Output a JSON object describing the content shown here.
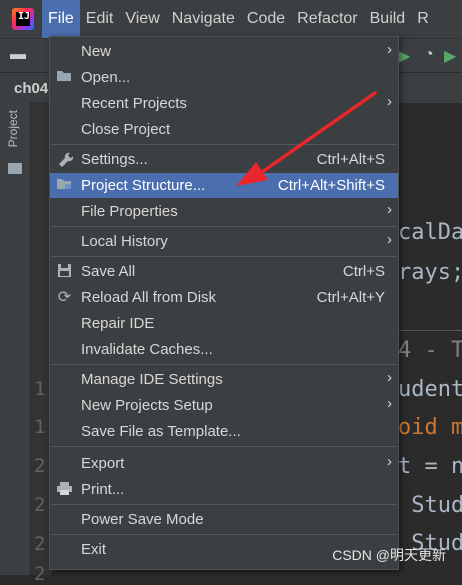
{
  "menubar": {
    "items": [
      {
        "label": "File"
      },
      {
        "label": "Edit"
      },
      {
        "label": "View"
      },
      {
        "label": "Navigate"
      },
      {
        "label": "Code"
      },
      {
        "label": "Refactor"
      },
      {
        "label": "Build"
      },
      {
        "label": "R"
      }
    ]
  },
  "editor": {
    "tab_label": "ch04",
    "project_tool_label": "Project",
    "line_numbers": [
      "1",
      "1",
      "2",
      "2",
      "2",
      "2"
    ],
    "code_lines": [
      "calDa",
      "rays;",
      "4 - T",
      "udent",
      "oid m",
      "t = n",
      " Stud",
      " Stud"
    ]
  },
  "file_menu": {
    "items": [
      {
        "label": "New",
        "shortcut": "",
        "submenu": true,
        "icon": ""
      },
      {
        "label": "Open...",
        "shortcut": "",
        "submenu": false,
        "icon": "folder-open-icon"
      },
      {
        "label": "Recent Projects",
        "shortcut": "",
        "submenu": true,
        "icon": ""
      },
      {
        "label": "Close Project",
        "shortcut": "",
        "submenu": false,
        "icon": ""
      },
      {
        "label": "Settings...",
        "shortcut": "Ctrl+Alt+S",
        "submenu": false,
        "icon": "wrench-icon"
      },
      {
        "label": "Project Structure...",
        "shortcut": "Ctrl+Alt+Shift+S",
        "submenu": false,
        "icon": "project-structure-icon"
      },
      {
        "label": "File Properties",
        "shortcut": "",
        "submenu": true,
        "icon": ""
      },
      {
        "label": "Local History",
        "shortcut": "",
        "submenu": true,
        "icon": ""
      },
      {
        "label": "Save All",
        "shortcut": "Ctrl+S",
        "submenu": false,
        "icon": "save-icon"
      },
      {
        "label": "Reload All from Disk",
        "shortcut": "Ctrl+Alt+Y",
        "submenu": false,
        "icon": "reload-icon"
      },
      {
        "label": "Repair IDE",
        "shortcut": "",
        "submenu": false,
        "icon": ""
      },
      {
        "label": "Invalidate Caches...",
        "shortcut": "",
        "submenu": false,
        "icon": ""
      },
      {
        "label": "Manage IDE Settings",
        "shortcut": "",
        "submenu": true,
        "icon": ""
      },
      {
        "label": "New Projects Setup",
        "shortcut": "",
        "submenu": true,
        "icon": ""
      },
      {
        "label": "Save File as Template...",
        "shortcut": "",
        "submenu": false,
        "icon": ""
      },
      {
        "label": "Export",
        "shortcut": "",
        "submenu": true,
        "icon": ""
      },
      {
        "label": "Print...",
        "shortcut": "",
        "submenu": false,
        "icon": "print-icon"
      },
      {
        "label": "Power Save Mode",
        "shortcut": "",
        "submenu": false,
        "icon": ""
      },
      {
        "label": "Exit",
        "shortcut": "",
        "submenu": false,
        "icon": ""
      }
    ],
    "selected_label": "Project Structure...",
    "submenu_glyph": "›"
  },
  "watermark": "CSDN @明天更新",
  "colors": {
    "menu_bg": "#3c3f41",
    "selection": "#4b6eaf",
    "annotation_arrow": "#e8262b"
  }
}
